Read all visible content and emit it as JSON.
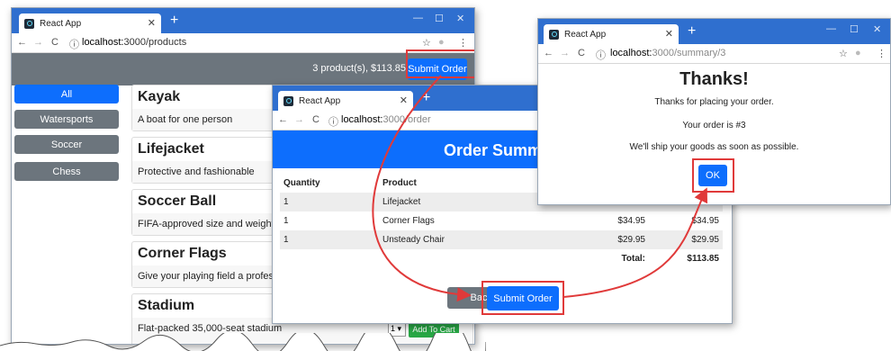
{
  "win1": {
    "tab_title": "React App",
    "url_host": "localhost:",
    "url_rest": "3000/products",
    "cart_summary": "3 product(s), $113.85",
    "submit_label": "Submit Order",
    "categories": [
      "All",
      "Watersports",
      "Soccer",
      "Chess"
    ],
    "products": [
      {
        "name": "Kayak",
        "desc": "A boat for one person"
      },
      {
        "name": "Lifejacket",
        "desc": "Protective and fashionable"
      },
      {
        "name": "Soccer Ball",
        "desc": "FIFA-approved size and weight"
      },
      {
        "name": "Corner Flags",
        "desc": "Give your playing field a professio"
      },
      {
        "name": "Stadium",
        "desc": "Flat-packed 35,000-seat stadium"
      }
    ],
    "qty_value": "1",
    "add_to_cart": "Add To Cart"
  },
  "win2": {
    "tab_title": "React App",
    "url_host": "localhost:",
    "url_rest": "3000/order",
    "header": "Order Summa",
    "columns": [
      "Quantity",
      "Product",
      "",
      ""
    ],
    "rows": [
      {
        "qty": "1",
        "product": "Lifejacket",
        "price": "",
        "subtotal": ""
      },
      {
        "qty": "1",
        "product": "Corner Flags",
        "price": "$34.95",
        "subtotal": "$34.95"
      },
      {
        "qty": "1",
        "product": "Unsteady Chair",
        "price": "$29.95",
        "subtotal": "$29.95"
      }
    ],
    "total_label": "Total:",
    "total_value": "$113.85",
    "back_label": "Back",
    "submit_label": "Submit Order"
  },
  "win3": {
    "tab_title": "React App",
    "url_host": "localhost:",
    "url_rest": "3000/summary/3",
    "heading": "Thanks!",
    "line1": "Thanks for placing your order.",
    "line2": "Your order is #3",
    "line3": "We'll ship your goods as soon as possible.",
    "ok_label": "OK"
  },
  "colors": {
    "accent": "#0d6efd",
    "titlebar": "#2f6fcf",
    "highlight": "#e03a3a",
    "success": "#28a745"
  }
}
